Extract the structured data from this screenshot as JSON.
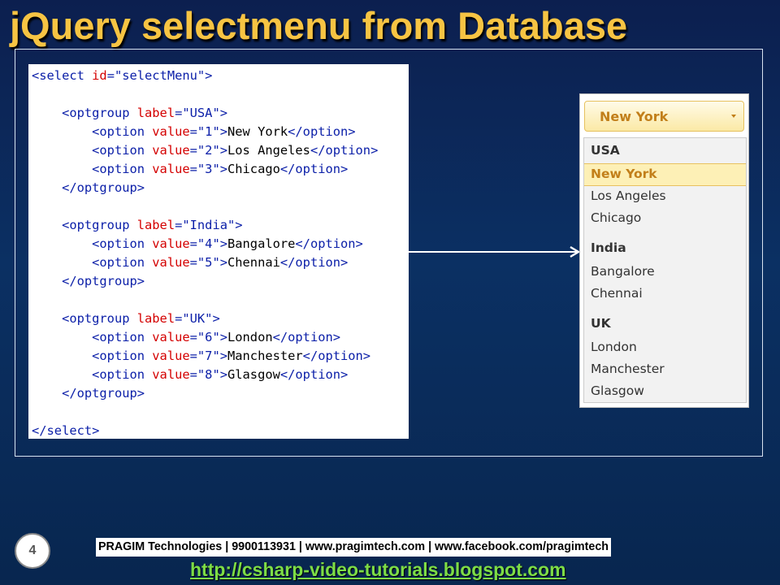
{
  "slide": {
    "title": "jQuery selectmenu from Database",
    "page_number": "4"
  },
  "code": {
    "lines": [
      [
        {
          "t": "tag",
          "v": "<select "
        },
        {
          "t": "attr",
          "v": "id"
        },
        {
          "t": "tag",
          "v": "="
        },
        {
          "t": "val",
          "v": "\"selectMenu\""
        },
        {
          "t": "tag",
          "v": ">"
        }
      ],
      [],
      [
        {
          "t": "text",
          "v": "    "
        },
        {
          "t": "tag",
          "v": "<optgroup "
        },
        {
          "t": "attr",
          "v": "label"
        },
        {
          "t": "tag",
          "v": "="
        },
        {
          "t": "val",
          "v": "\"USA\""
        },
        {
          "t": "tag",
          "v": ">"
        }
      ],
      [
        {
          "t": "text",
          "v": "        "
        },
        {
          "t": "tag",
          "v": "<option "
        },
        {
          "t": "attr",
          "v": "value"
        },
        {
          "t": "tag",
          "v": "="
        },
        {
          "t": "val",
          "v": "\"1\""
        },
        {
          "t": "tag",
          "v": ">"
        },
        {
          "t": "text",
          "v": "New York"
        },
        {
          "t": "tag",
          "v": "</option>"
        }
      ],
      [
        {
          "t": "text",
          "v": "        "
        },
        {
          "t": "tag",
          "v": "<option "
        },
        {
          "t": "attr",
          "v": "value"
        },
        {
          "t": "tag",
          "v": "="
        },
        {
          "t": "val",
          "v": "\"2\""
        },
        {
          "t": "tag",
          "v": ">"
        },
        {
          "t": "text",
          "v": "Los Angeles"
        },
        {
          "t": "tag",
          "v": "</option>"
        }
      ],
      [
        {
          "t": "text",
          "v": "        "
        },
        {
          "t": "tag",
          "v": "<option "
        },
        {
          "t": "attr",
          "v": "value"
        },
        {
          "t": "tag",
          "v": "="
        },
        {
          "t": "val",
          "v": "\"3\""
        },
        {
          "t": "tag",
          "v": ">"
        },
        {
          "t": "text",
          "v": "Chicago"
        },
        {
          "t": "tag",
          "v": "</option>"
        }
      ],
      [
        {
          "t": "text",
          "v": "    "
        },
        {
          "t": "tag",
          "v": "</optgroup>"
        }
      ],
      [],
      [
        {
          "t": "text",
          "v": "    "
        },
        {
          "t": "tag",
          "v": "<optgroup "
        },
        {
          "t": "attr",
          "v": "label"
        },
        {
          "t": "tag",
          "v": "="
        },
        {
          "t": "val",
          "v": "\"India\""
        },
        {
          "t": "tag",
          "v": ">"
        }
      ],
      [
        {
          "t": "text",
          "v": "        "
        },
        {
          "t": "tag",
          "v": "<option "
        },
        {
          "t": "attr",
          "v": "value"
        },
        {
          "t": "tag",
          "v": "="
        },
        {
          "t": "val",
          "v": "\"4\""
        },
        {
          "t": "tag",
          "v": ">"
        },
        {
          "t": "text",
          "v": "Bangalore"
        },
        {
          "t": "tag",
          "v": "</option>"
        }
      ],
      [
        {
          "t": "text",
          "v": "        "
        },
        {
          "t": "tag",
          "v": "<option "
        },
        {
          "t": "attr",
          "v": "value"
        },
        {
          "t": "tag",
          "v": "="
        },
        {
          "t": "val",
          "v": "\"5\""
        },
        {
          "t": "tag",
          "v": ">"
        },
        {
          "t": "text",
          "v": "Chennai"
        },
        {
          "t": "tag",
          "v": "</option>"
        }
      ],
      [
        {
          "t": "text",
          "v": "    "
        },
        {
          "t": "tag",
          "v": "</optgroup>"
        }
      ],
      [],
      [
        {
          "t": "text",
          "v": "    "
        },
        {
          "t": "tag",
          "v": "<optgroup "
        },
        {
          "t": "attr",
          "v": "label"
        },
        {
          "t": "tag",
          "v": "="
        },
        {
          "t": "val",
          "v": "\"UK\""
        },
        {
          "t": "tag",
          "v": ">"
        }
      ],
      [
        {
          "t": "text",
          "v": "        "
        },
        {
          "t": "tag",
          "v": "<option "
        },
        {
          "t": "attr",
          "v": "value"
        },
        {
          "t": "tag",
          "v": "="
        },
        {
          "t": "val",
          "v": "\"6\""
        },
        {
          "t": "tag",
          "v": ">"
        },
        {
          "t": "text",
          "v": "London"
        },
        {
          "t": "tag",
          "v": "</option>"
        }
      ],
      [
        {
          "t": "text",
          "v": "        "
        },
        {
          "t": "tag",
          "v": "<option "
        },
        {
          "t": "attr",
          "v": "value"
        },
        {
          "t": "tag",
          "v": "="
        },
        {
          "t": "val",
          "v": "\"7\""
        },
        {
          "t": "tag",
          "v": ">"
        },
        {
          "t": "text",
          "v": "Manchester"
        },
        {
          "t": "tag",
          "v": "</option>"
        }
      ],
      [
        {
          "t": "text",
          "v": "        "
        },
        {
          "t": "tag",
          "v": "<option "
        },
        {
          "t": "attr",
          "v": "value"
        },
        {
          "t": "tag",
          "v": "="
        },
        {
          "t": "val",
          "v": "\"8\""
        },
        {
          "t": "tag",
          "v": ">"
        },
        {
          "t": "text",
          "v": "Glasgow"
        },
        {
          "t": "tag",
          "v": "</option>"
        }
      ],
      [
        {
          "t": "text",
          "v": "    "
        },
        {
          "t": "tag",
          "v": "</optgroup>"
        }
      ],
      [],
      [
        {
          "t": "tag",
          "v": "</select>"
        }
      ]
    ]
  },
  "selectmenu": {
    "selected_label": "New York",
    "groups": [
      {
        "label": "USA",
        "options": [
          "New York",
          "Los Angeles",
          "Chicago"
        ]
      },
      {
        "label": "India",
        "options": [
          "Bangalore",
          "Chennai"
        ]
      },
      {
        "label": "UK",
        "options": [
          "London",
          "Manchester",
          "Glasgow"
        ]
      }
    ],
    "active_option": "New York"
  },
  "footer": {
    "contact": "PRAGIM Technologies | 9900113931 | www.pragimtech.com | www.facebook.com/pragimtech",
    "link": "http://csharp-video-tutorials.blogspot.com"
  },
  "colors": {
    "title": "#f7c443",
    "code_tag": "#0a1ea8",
    "code_attr": "#d40000",
    "menu_accent": "#c27f1a",
    "link": "#7ddd46"
  }
}
